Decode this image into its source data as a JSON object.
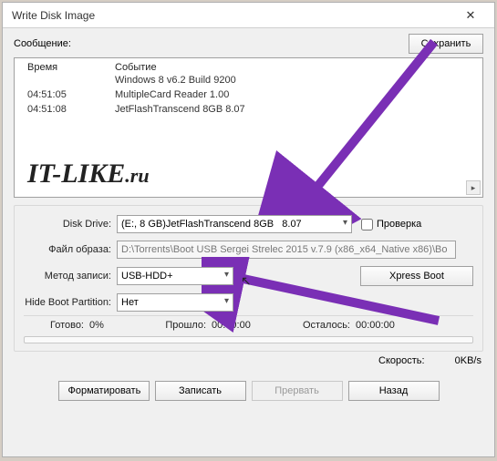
{
  "window": {
    "title": "Write Disk Image"
  },
  "message_section": {
    "label": "Сообщение:",
    "save_btn": "Сохранить"
  },
  "log": {
    "col_time": "Время",
    "col_event": "Событие",
    "rows": [
      {
        "time": "",
        "event": "Windows 8 v6.2 Build 9200"
      },
      {
        "time": "04:51:05",
        "event": "MultipleCard  Reader   1.00"
      },
      {
        "time": "04:51:08",
        "event": "JetFlashTranscend 8GB   8.07"
      }
    ]
  },
  "logo": {
    "main": "IT-LIKE",
    "suffix": ".ru"
  },
  "form": {
    "disk_label": "Disk Drive:",
    "disk_value": "(E:, 8 GB)JetFlashTranscend 8GB   8.07",
    "check_label": "Проверка",
    "image_label": "Файл образа:",
    "image_value": "D:\\Torrents\\Boot USB Sergei Strelec 2015 v.7.9 (x86_x64_Native x86)\\Bo",
    "method_label": "Метод записи:",
    "method_value": "USB-HDD+",
    "xpress_btn": "Xpress Boot",
    "hide_label": "Hide Boot Partition:",
    "hide_value": "Нет"
  },
  "progress": {
    "ready_label": "Готово:",
    "ready_value": "0%",
    "elapsed_label": "Прошло:",
    "elapsed_value": "00:00:00",
    "remain_label": "Осталось:",
    "remain_value": "00:00:00"
  },
  "speed": {
    "label": "Скорость:",
    "value": "0KB/s"
  },
  "buttons": {
    "format": "Форматировать",
    "write": "Записать",
    "abort": "Прервать",
    "back": "Назад"
  }
}
